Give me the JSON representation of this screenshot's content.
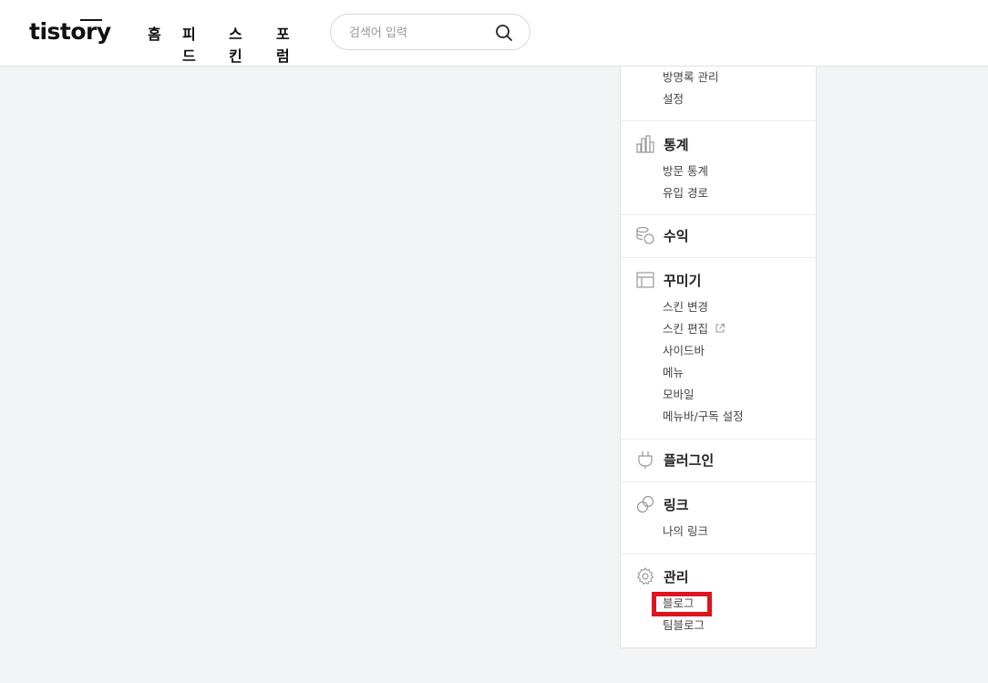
{
  "header": {
    "logo": "tistory",
    "nav": {
      "home": "홈",
      "feed": "피드",
      "skin": "스킨",
      "forum": "포럼"
    },
    "search": {
      "placeholder": "검색어 입력",
      "icon": "search-icon"
    }
  },
  "sidebar": {
    "top_items": [
      "방명록 관리",
      "설정"
    ],
    "stats": {
      "title": "통계",
      "icon": "bar-chart-icon",
      "items": [
        "방문 통계",
        "유입 경로"
      ]
    },
    "revenue": {
      "title": "수익",
      "icon": "coins-icon"
    },
    "decorate": {
      "title": "꾸미기",
      "icon": "layout-icon",
      "items": [
        "스킨 변경",
        "스킨 편집",
        "사이드바",
        "메뉴",
        "모바일",
        "메뉴바/구독 설정"
      ]
    },
    "plugin": {
      "title": "플러그인",
      "icon": "plug-icon"
    },
    "link": {
      "title": "링크",
      "icon": "link-icon",
      "items": [
        "나의 링크"
      ]
    },
    "manage": {
      "title": "관리",
      "icon": "gear-icon",
      "items": [
        "블로그",
        "팀블로그"
      ]
    }
  },
  "colors": {
    "highlight": "#e0141e",
    "background": "#f3f4f6"
  }
}
